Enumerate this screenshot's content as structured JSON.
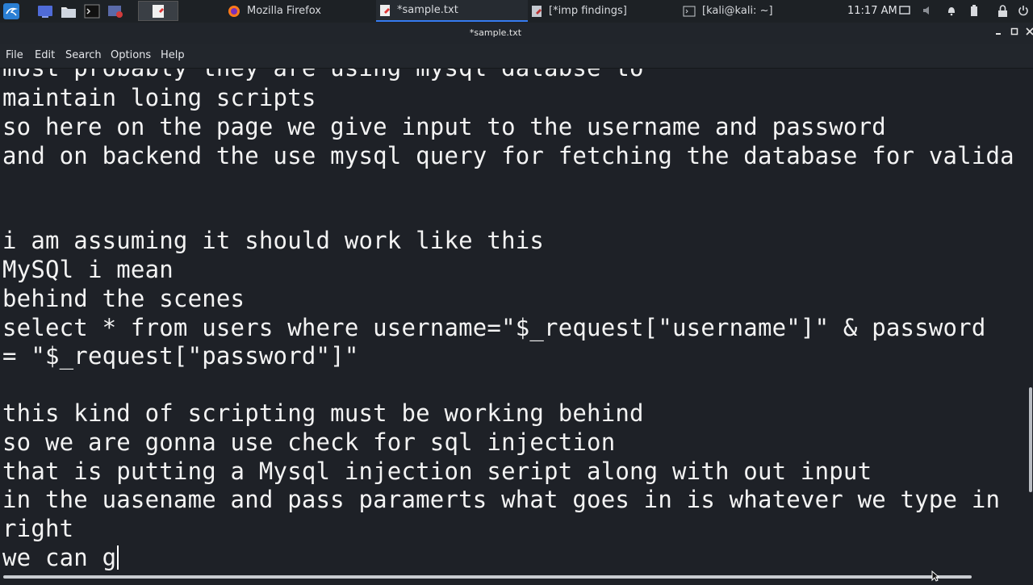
{
  "taskbar": {
    "tasks": [
      {
        "label": "Mozilla Firefox",
        "icon": "firefox-icon"
      },
      {
        "label": "*sample.txt",
        "icon": "text-editor-icon"
      },
      {
        "label": "[*imp findings]",
        "icon": "notes-icon"
      },
      {
        "label": "[kali@kali: ~]",
        "icon": "terminal-icon"
      }
    ],
    "clock": "11:17 AM"
  },
  "window": {
    "title": "*sample.txt"
  },
  "menu": {
    "items": [
      "File",
      "Edit",
      "Search",
      "Options",
      "Help"
    ]
  },
  "editor": {
    "lines": [
      "most probably they are using mysql databse to",
      "maintain loing scripts",
      "so here on the page we give input to the username and password",
      "and on backend the use mysql query for fetching the database for valida",
      "",
      "",
      "i am assuming it should work like this",
      "MySQl i mean",
      "behind the scenes",
      "select * from users where username=\"$_request[\"username\"]\" & password",
      "= \"$_request[\"password\"]\"",
      "",
      "this kind of scripting must be working behind",
      "so we are gonna use check for sql injection",
      "that is putting a Mysql injection seript along with out input",
      "in the uasename and pass paramerts what goes in is whatever we type in",
      "right",
      "we can g"
    ]
  },
  "colors": {
    "background": "#1e2127",
    "text": "#f3f3f3",
    "accent": "#367bf0"
  }
}
